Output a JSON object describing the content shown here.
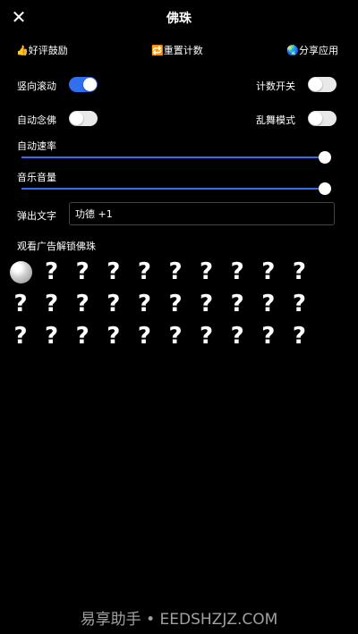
{
  "header": {
    "close_icon": "close-icon",
    "title": "佛珠"
  },
  "actions": [
    {
      "icon": "thumbs-up-icon",
      "label": "👍好评鼓励"
    },
    {
      "icon": "reset-icon",
      "label": "🔁重置计数"
    },
    {
      "icon": "globe-icon",
      "label": "🌏分享应用"
    }
  ],
  "toggles": {
    "vertical_scroll": {
      "label": "竖向滚动",
      "on": true
    },
    "counter": {
      "label": "计数开关",
      "on": false
    },
    "auto_chant": {
      "label": "自动念佛",
      "on": false
    },
    "chaos_dance": {
      "label": "乱舞模式",
      "on": false
    }
  },
  "sliders": {
    "auto_speed": {
      "label": "自动速率",
      "value_pct": 100
    },
    "music_volume": {
      "label": "音乐音量",
      "value_pct": 100
    }
  },
  "popup_text": {
    "label": "弹出文字",
    "value": "功德 +1"
  },
  "unlock": {
    "title": "观看广告解锁佛珠",
    "slots": [
      "bead",
      "?",
      "?",
      "?",
      "?",
      "?",
      "?",
      "?",
      "?",
      "?",
      "?",
      "?",
      "?",
      "?",
      "?",
      "?",
      "?",
      "?",
      "?",
      "?",
      "?",
      "?",
      "?",
      "?",
      "?",
      "?",
      "?",
      "?",
      "?",
      "?"
    ]
  },
  "watermark": "易享助手 • EEDSHZJZ.COM",
  "colors": {
    "accent": "#2f6ff0",
    "background": "#000000"
  }
}
